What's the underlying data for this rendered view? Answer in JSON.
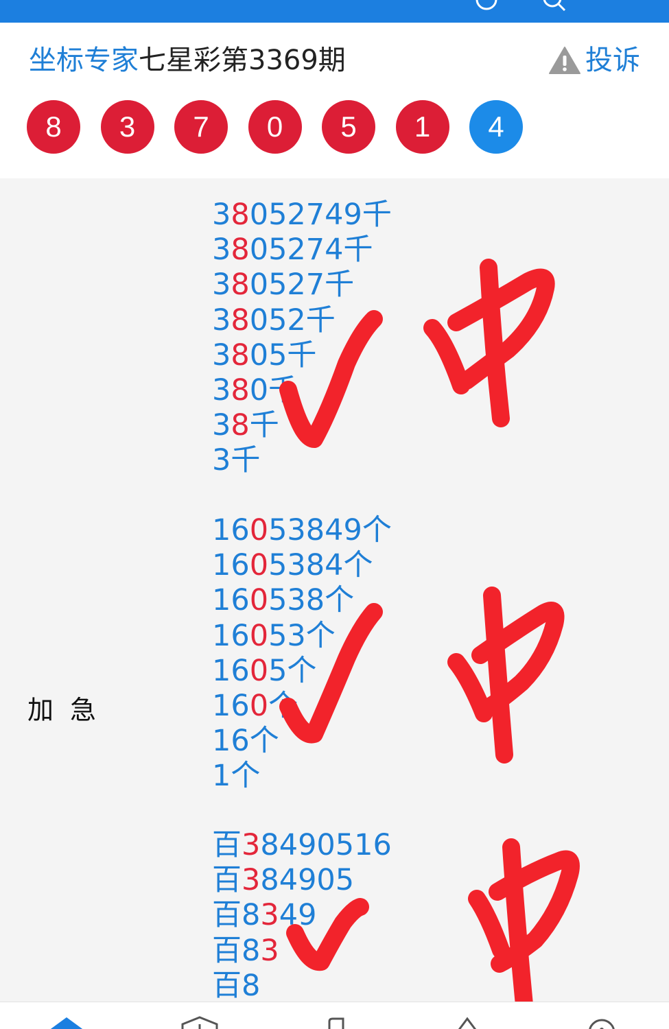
{
  "header": {
    "author": "坐标专家",
    "title": "七星彩第3369期",
    "complain_label": "投诉",
    "balls": [
      {
        "value": "8",
        "color": "red"
      },
      {
        "value": "3",
        "color": "red"
      },
      {
        "value": "7",
        "color": "red"
      },
      {
        "value": "0",
        "color": "red"
      },
      {
        "value": "5",
        "color": "red"
      },
      {
        "value": "1",
        "color": "red"
      },
      {
        "value": "4",
        "color": "blue"
      }
    ]
  },
  "side_label": "加急",
  "blocks": [
    {
      "rows": [
        {
          "pre": "3",
          "hl": "8",
          "post": "052749千"
        },
        {
          "pre": "3",
          "hl": "8",
          "post": "05274千"
        },
        {
          "pre": "3",
          "hl": "8",
          "post": "0527千"
        },
        {
          "pre": "3",
          "hl": "8",
          "post": "052千"
        },
        {
          "pre": "3",
          "hl": "8",
          "post": "05千"
        },
        {
          "pre": "3",
          "hl": "8",
          "post": "0千"
        },
        {
          "pre": "3",
          "hl": "8",
          "post": "千"
        },
        {
          "pre": "3",
          "hl": "",
          "post": "千"
        }
      ]
    },
    {
      "rows": [
        {
          "pre": "16",
          "hl": "0",
          "post": "53849个"
        },
        {
          "pre": "16",
          "hl": "0",
          "post": "5384个"
        },
        {
          "pre": "16",
          "hl": "0",
          "post": "538个"
        },
        {
          "pre": "16",
          "hl": "0",
          "post": "53个"
        },
        {
          "pre": "16",
          "hl": "0",
          "post": "5个"
        },
        {
          "pre": "16",
          "hl": "0",
          "post": "个"
        },
        {
          "pre": "16",
          "hl": "",
          "post": "个"
        },
        {
          "pre": "1",
          "hl": "",
          "post": "个"
        }
      ]
    },
    {
      "rows": [
        {
          "pre": "百",
          "hl": "3",
          "post": "8490516"
        },
        {
          "pre": "百",
          "hl": "3",
          "post": "84905"
        },
        {
          "pre": "百8",
          "hl": "3",
          "post": "49"
        },
        {
          "pre": "百8",
          "hl": "3",
          "post": ""
        },
        {
          "pre": "百8",
          "hl": "",
          "post": ""
        }
      ]
    }
  ],
  "colors": {
    "brand_blue": "#1f7fd6",
    "ball_red": "#dc1e36",
    "ball_blue": "#1c8be8",
    "highlight_red": "#e3263a",
    "ink_red": "#f2232b"
  }
}
